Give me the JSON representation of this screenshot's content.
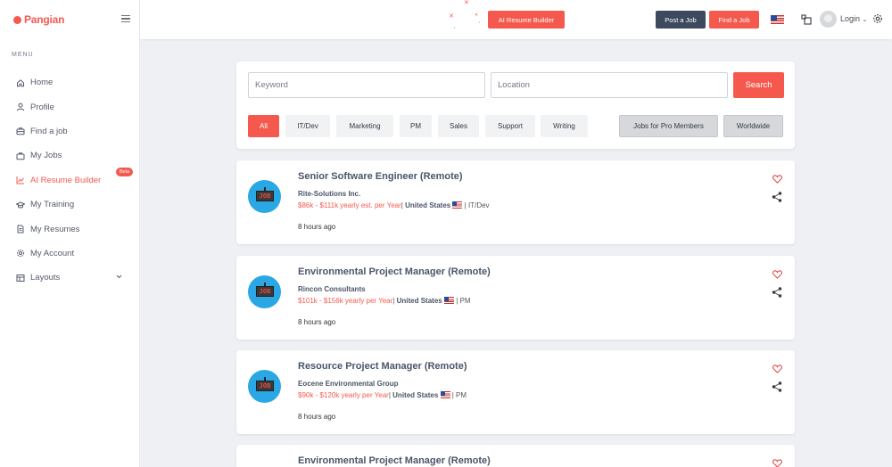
{
  "brand": {
    "name": "Pangian",
    "color": "#f5594e"
  },
  "sidebar": {
    "menu_title": "MENU",
    "items": [
      {
        "label": "Home",
        "icon": "home-icon"
      },
      {
        "label": "Profile",
        "icon": "user-icon"
      },
      {
        "label": "Find a job",
        "icon": "briefcase-icon"
      },
      {
        "label": "My Jobs",
        "icon": "briefcase-icon"
      },
      {
        "label": "AI Resume Builder",
        "icon": "chart-icon",
        "badge": "Beta",
        "active": true
      },
      {
        "label": "My Training",
        "icon": "graduation-cap-icon"
      },
      {
        "label": "My Resumes",
        "icon": "document-icon"
      },
      {
        "label": "My Account",
        "icon": "gear-icon"
      },
      {
        "label": "Layouts",
        "icon": "layout-icon"
      }
    ]
  },
  "topbar": {
    "ai_resume_builder": "AI Resume Builder",
    "post_job": "Post a Job",
    "find_job": "Find a Job",
    "login": "Login"
  },
  "search": {
    "keyword_placeholder": "Keyword",
    "location_placeholder": "Location",
    "search_label": "Search",
    "filters": [
      "All",
      "IT/Dev",
      "Marketing",
      "PM",
      "Sales",
      "Support",
      "Writing"
    ],
    "active_filter": "All",
    "pro_members": "Jobs for Pro Members",
    "worldwide": "Worldwide"
  },
  "jobs": [
    {
      "title": "Senior Software Engineer (Remote)",
      "company": "Rite-Solutions Inc.",
      "salary": "$86k - $111k yearly est. per Year",
      "country": "United States",
      "category": "IT/Dev",
      "posted": "8 hours ago"
    },
    {
      "title": "Environmental Project Manager (Remote)",
      "company": "Rincon Consultants",
      "salary": "$101k - $156k yearly per Year",
      "country": "United States",
      "category": "PM",
      "posted": "8 hours ago"
    },
    {
      "title": "Resource Project Manager (Remote)",
      "company": "Eocene Environmental Group",
      "salary": "$90k - $120k yearly per Year",
      "country": "United States",
      "category": "PM",
      "posted": "8 hours ago"
    },
    {
      "title": "Environmental Project Manager (Remote)"
    }
  ]
}
